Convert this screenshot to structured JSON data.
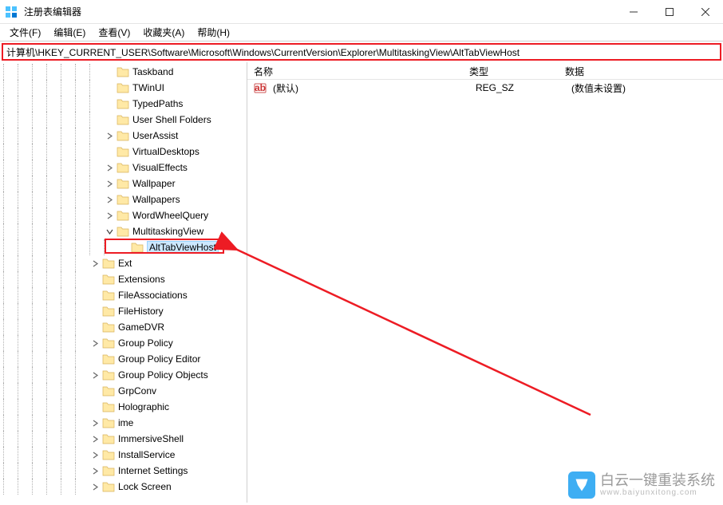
{
  "window": {
    "title": "注册表编辑器"
  },
  "menu": {
    "file": "文件(F)",
    "edit": "编辑(E)",
    "view": "查看(V)",
    "favorites": "收藏夹(A)",
    "help": "帮助(H)"
  },
  "address": "计算机\\HKEY_CURRENT_USER\\Software\\Microsoft\\Windows\\CurrentVersion\\Explorer\\MultitaskingView\\AltTabViewHost",
  "tree": [
    {
      "label": "Taskband",
      "depth": 7,
      "exp": null
    },
    {
      "label": "TWinUI",
      "depth": 7,
      "exp": null
    },
    {
      "label": "TypedPaths",
      "depth": 7,
      "exp": null
    },
    {
      "label": "User Shell Folders",
      "depth": 7,
      "exp": null
    },
    {
      "label": "UserAssist",
      "depth": 7,
      "exp": "closed"
    },
    {
      "label": "VirtualDesktops",
      "depth": 7,
      "exp": null
    },
    {
      "label": "VisualEffects",
      "depth": 7,
      "exp": "closed"
    },
    {
      "label": "Wallpaper",
      "depth": 7,
      "exp": "closed"
    },
    {
      "label": "Wallpapers",
      "depth": 7,
      "exp": "closed"
    },
    {
      "label": "WordWheelQuery",
      "depth": 7,
      "exp": "closed"
    },
    {
      "label": "MultitaskingView",
      "depth": 7,
      "exp": "open"
    },
    {
      "label": "AltTabViewHost",
      "depth": 8,
      "exp": null,
      "selected": true
    },
    {
      "label": "Ext",
      "depth": 6,
      "exp": "closed"
    },
    {
      "label": "Extensions",
      "depth": 6,
      "exp": null
    },
    {
      "label": "FileAssociations",
      "depth": 6,
      "exp": null
    },
    {
      "label": "FileHistory",
      "depth": 6,
      "exp": null
    },
    {
      "label": "GameDVR",
      "depth": 6,
      "exp": null
    },
    {
      "label": "Group Policy",
      "depth": 6,
      "exp": "closed"
    },
    {
      "label": "Group Policy Editor",
      "depth": 6,
      "exp": null
    },
    {
      "label": "Group Policy Objects",
      "depth": 6,
      "exp": "closed"
    },
    {
      "label": "GrpConv",
      "depth": 6,
      "exp": null
    },
    {
      "label": "Holographic",
      "depth": 6,
      "exp": null
    },
    {
      "label": "ime",
      "depth": 6,
      "exp": "closed"
    },
    {
      "label": "ImmersiveShell",
      "depth": 6,
      "exp": "closed"
    },
    {
      "label": "InstallService",
      "depth": 6,
      "exp": "closed"
    },
    {
      "label": "Internet Settings",
      "depth": 6,
      "exp": "closed"
    },
    {
      "label": "Lock Screen",
      "depth": 6,
      "exp": "closed"
    }
  ],
  "list": {
    "headers": {
      "name": "名称",
      "type": "类型",
      "data": "数据"
    },
    "rows": [
      {
        "name": "(默认)",
        "type": "REG_SZ",
        "data": "(数值未设置)"
      }
    ]
  },
  "watermark": {
    "text": "白云一键重装系统",
    "sub": "www.baiyunxitong.com"
  }
}
